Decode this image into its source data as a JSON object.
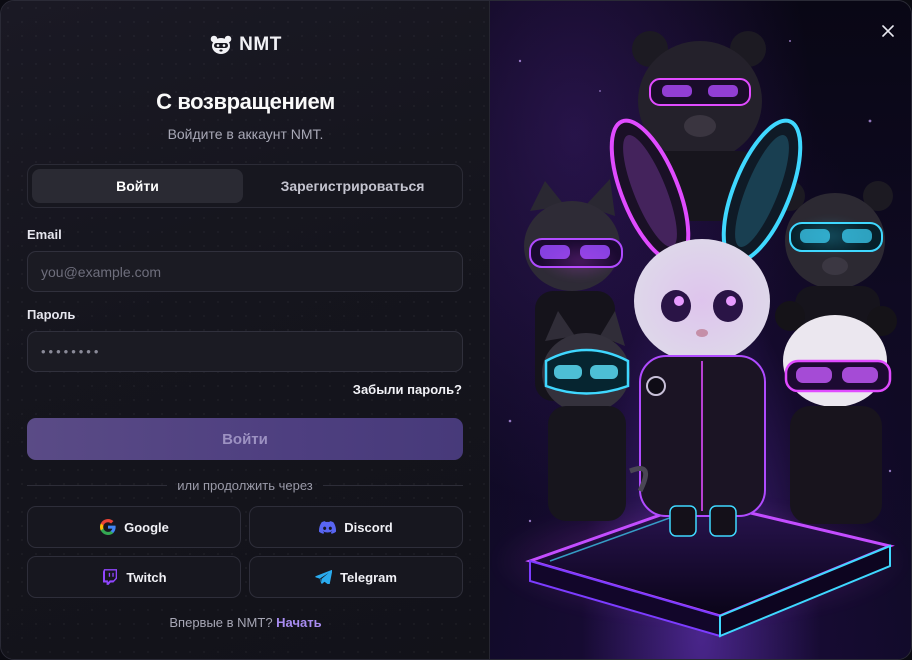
{
  "brand": {
    "name": "NMT",
    "icon": "panda-mascot-icon"
  },
  "header": {
    "title": "С возвращением",
    "subtitle": "Войдите в аккаунт NMT."
  },
  "tabs": [
    {
      "label": "Войти",
      "active": true
    },
    {
      "label": "Зарегистрироваться",
      "active": false
    }
  ],
  "form": {
    "email_label": "Email",
    "email_placeholder": "you@example.com",
    "password_label": "Пароль",
    "password_value": "••••••••",
    "forgot_label": "Забыли пароль?",
    "submit_label": "Войти"
  },
  "divider_text": "или продолжить через",
  "social": [
    {
      "label": "Google",
      "icon": "google-icon"
    },
    {
      "label": "Discord",
      "icon": "discord-icon"
    },
    {
      "label": "Twitch",
      "icon": "twitch-icon"
    },
    {
      "label": "Telegram",
      "icon": "telegram-icon"
    }
  ],
  "footer": {
    "text": "Впервые в NMT?",
    "link": "Начать"
  },
  "colors": {
    "accent": "#a88cf0",
    "submit_bg": "#4e3f80",
    "panel_bg": "#15151d",
    "neon_pink": "#e04bff",
    "neon_cyan": "#3fd8ff"
  }
}
